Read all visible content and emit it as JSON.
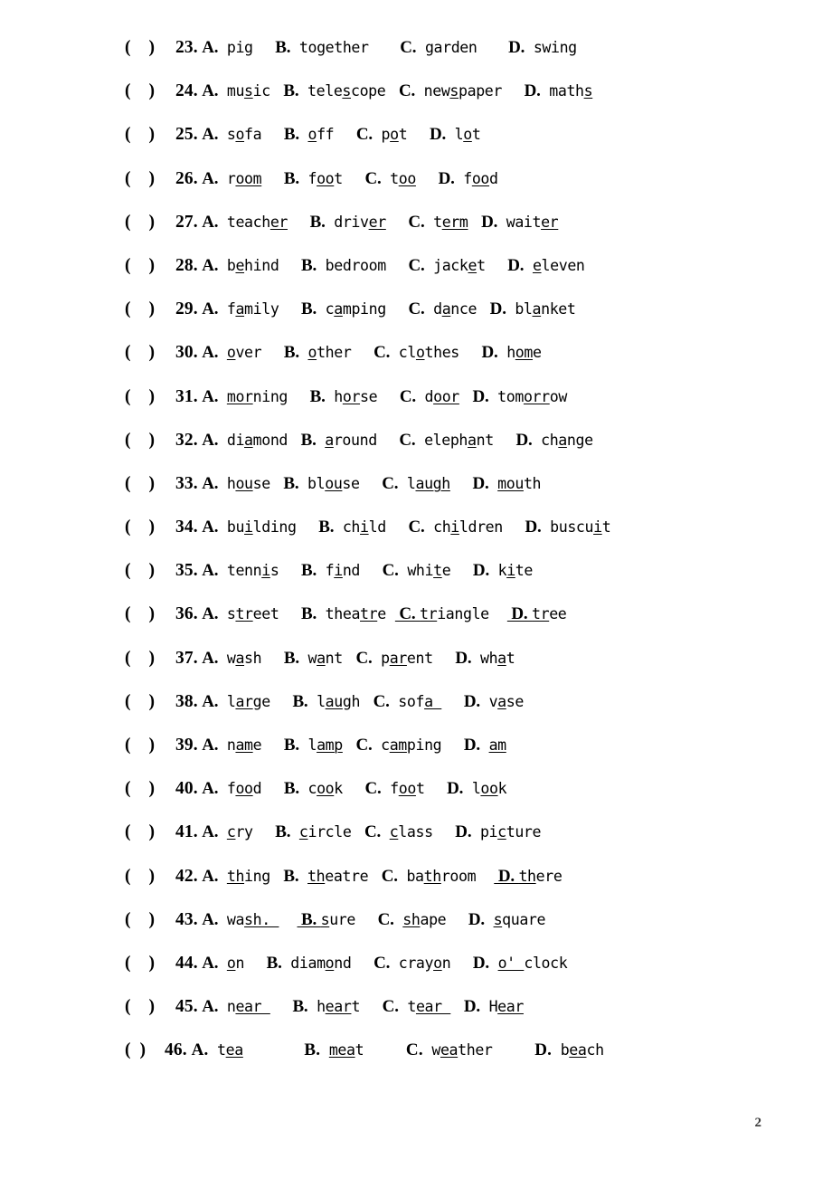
{
  "document": {
    "type": "worksheet",
    "subject": "English pronunciation multiple choice",
    "page_number": "2",
    "bracket": "(    )",
    "bracket_wide": "(  )"
  },
  "questions": [
    {
      "number": "23.",
      "options": [
        {
          "label": "A.",
          "pre": "pig",
          "mid": "",
          "post": ""
        },
        {
          "label": "B.",
          "pre": "together",
          "mid": "",
          "post": ""
        },
        {
          "label": "C.",
          "pre": "garden",
          "mid": "",
          "post": ""
        },
        {
          "label": "D.",
          "pre": "swing",
          "mid": "",
          "post": ""
        }
      ],
      "gaps": [
        2,
        3,
        3
      ]
    },
    {
      "number": "24.",
      "options": [
        {
          "label": "A.",
          "pre": "mu",
          "mid": "s",
          "post": "ic"
        },
        {
          "label": "B.",
          "pre": "tele",
          "mid": "s",
          "post": "cope"
        },
        {
          "label": "C.",
          "pre": "new",
          "mid": "s",
          "post": "paper"
        },
        {
          "label": "D.",
          "pre": "math",
          "mid": "s",
          "post": ""
        }
      ],
      "gaps": [
        1,
        1,
        2
      ]
    },
    {
      "number": "25.",
      "options": [
        {
          "label": "A.",
          "pre": "s",
          "mid": "o",
          "post": "fa"
        },
        {
          "label": "B.",
          "pre": "",
          "mid": "o",
          "post": "ff"
        },
        {
          "label": "C.",
          "pre": "p",
          "mid": "o",
          "post": "t"
        },
        {
          "label": "D.",
          "pre": "l",
          "mid": "o",
          "post": "t"
        }
      ],
      "gaps": [
        2,
        2,
        2
      ]
    },
    {
      "number": "26.",
      "options": [
        {
          "label": "A.",
          "pre": "r",
          "mid": "oom",
          "post": ""
        },
        {
          "label": "B.",
          "pre": "f",
          "mid": "oo",
          "post": "t"
        },
        {
          "label": "C.",
          "pre": "t",
          "mid": "oo",
          "post": ""
        },
        {
          "label": "D.",
          "pre": "f",
          "mid": "oo",
          "post": "d"
        }
      ],
      "gaps": [
        2,
        2,
        2
      ]
    },
    {
      "number": "27.",
      "options": [
        {
          "label": "A.",
          "pre": "teach",
          "mid": "er",
          "post": ""
        },
        {
          "label": "B.",
          "pre": "driv",
          "mid": "er",
          "post": ""
        },
        {
          "label": "C.",
          "pre": "t",
          "mid": "erm",
          "post": ""
        },
        {
          "label": "D.",
          "pre": "wait",
          "mid": "er",
          "post": ""
        }
      ],
      "gaps": [
        2,
        2,
        1
      ]
    },
    {
      "number": "28.",
      "options": [
        {
          "label": "A.",
          "pre": "b",
          "mid": "e",
          "post": "hind"
        },
        {
          "label": "B.",
          "pre": "bedroom",
          "mid": "",
          "post": ""
        },
        {
          "label": "C.",
          "pre": "jack",
          "mid": "e",
          "post": "t"
        },
        {
          "label": "D.",
          "pre": "",
          "mid": "e",
          "post": "leven"
        }
      ],
      "gaps": [
        2,
        2,
        2
      ]
    },
    {
      "number": "29.",
      "options": [
        {
          "label": "A.",
          "pre": "f",
          "mid": "a",
          "post": "mily"
        },
        {
          "label": "B.",
          "pre": "c",
          "mid": "a",
          "post": "mping"
        },
        {
          "label": "C.",
          "pre": "d",
          "mid": "a",
          "post": "nce"
        },
        {
          "label": "D.",
          "pre": "bl",
          "mid": "a",
          "post": "nket"
        }
      ],
      "gaps": [
        2,
        2,
        1
      ]
    },
    {
      "number": "30.",
      "options": [
        {
          "label": "A.",
          "pre": "",
          "mid": "o",
          "post": "ver"
        },
        {
          "label": "B.",
          "pre": "",
          "mid": "o",
          "post": "ther"
        },
        {
          "label": "C.",
          "pre": "cl",
          "mid": "o",
          "post": "thes"
        },
        {
          "label": "D.",
          "pre": "h",
          "mid": "om",
          "post": "e"
        }
      ],
      "gaps": [
        2,
        2,
        2
      ]
    },
    {
      "number": "31.",
      "options": [
        {
          "label": "A.",
          "pre": "",
          "mid": "mor",
          "post": "ning"
        },
        {
          "label": "B.",
          "pre": "h",
          "mid": "or",
          "post": "se"
        },
        {
          "label": "C.",
          "pre": "d",
          "mid": "oor",
          "post": ""
        },
        {
          "label": "D.",
          "pre": "tom",
          "mid": "orr",
          "post": "ow"
        }
      ],
      "gaps": [
        2,
        2,
        1
      ]
    },
    {
      "number": "32.",
      "options": [
        {
          "label": "A.",
          "pre": "di",
          "mid": "a",
          "post": "mond"
        },
        {
          "label": "B.",
          "pre": "",
          "mid": "a",
          "post": "round"
        },
        {
          "label": "C.",
          "pre": "eleph",
          "mid": "a",
          "post": "nt"
        },
        {
          "label": "D.",
          "pre": "ch",
          "mid": "a",
          "post": "nge"
        }
      ],
      "gaps": [
        1,
        2,
        2
      ]
    },
    {
      "number": "33.",
      "options": [
        {
          "label": "A.",
          "pre": "h",
          "mid": "ou",
          "post": "se"
        },
        {
          "label": "B.",
          "pre": "bl",
          "mid": "ou",
          "post": "se"
        },
        {
          "label": "C.",
          "pre": "l",
          "mid": "augh",
          "post": ""
        },
        {
          "label": "D.",
          "pre": "",
          "mid": "mou",
          "post": "th"
        }
      ],
      "gaps": [
        1,
        2,
        2
      ]
    },
    {
      "number": "34.",
      "options": [
        {
          "label": "A.",
          "pre": "bu",
          "mid": "i",
          "post": "lding"
        },
        {
          "label": "B.",
          "pre": "ch",
          "mid": "i",
          "post": "ld"
        },
        {
          "label": "C.",
          "pre": "ch",
          "mid": "i",
          "post": "ldren"
        },
        {
          "label": "D.",
          "pre": "buscu",
          "mid": "i",
          "post": "t"
        }
      ],
      "gaps": [
        2,
        2,
        2
      ]
    },
    {
      "number": "35.",
      "options": [
        {
          "label": "A.",
          "pre": "tenn",
          "mid": "i",
          "post": "s"
        },
        {
          "label": "B.",
          "pre": "f",
          "mid": "i",
          "post": "nd"
        },
        {
          "label": "C.",
          "pre": "whi",
          "mid": "t",
          "post": "e"
        },
        {
          "label": "D.",
          "pre": "k",
          "mid": "i",
          "post": "te"
        }
      ],
      "gaps": [
        2,
        2,
        2
      ]
    },
    {
      "number": "36.",
      "options": [
        {
          "label": "A.",
          "pre": "s",
          "mid": "tr",
          "post": "eet"
        },
        {
          "label": "B.",
          "pre": "thea",
          "mid": "tr",
          "post": "e"
        },
        {
          "label": "C.",
          "labelUnderlined": true,
          "pre": "",
          "mid": "tr",
          "post": "iangle"
        },
        {
          "label": "D.",
          "labelUnderlined": true,
          "pre": "",
          "mid": "tr",
          "post": "ee"
        }
      ],
      "gaps": [
        2,
        1,
        2
      ]
    },
    {
      "number": "37.",
      "options": [
        {
          "label": "A.",
          "pre": "w",
          "mid": "a",
          "post": "sh"
        },
        {
          "label": "B.",
          "pre": "w",
          "mid": "a",
          "post": "nt"
        },
        {
          "label": "C.",
          "pre": "p",
          "mid": "ar",
          "post": "ent"
        },
        {
          "label": "D.",
          "pre": "wh",
          "mid": "a",
          "post": "t"
        }
      ],
      "gaps": [
        2,
        1,
        2
      ]
    },
    {
      "number": "38.",
      "options": [
        {
          "label": "A.",
          "pre": "l",
          "mid": "ar",
          "post": "ge"
        },
        {
          "label": "B.",
          "pre": "l",
          "mid": "au",
          "post": "gh"
        },
        {
          "label": "C.",
          "pre": "sof",
          "mid": "a ",
          "post": ""
        },
        {
          "label": "D.",
          "pre": "v",
          "mid": "a",
          "post": "se"
        }
      ],
      "gaps": [
        2,
        1,
        2
      ]
    },
    {
      "number": "39.",
      "options": [
        {
          "label": "A.",
          "pre": "n",
          "mid": "am",
          "post": "e"
        },
        {
          "label": "B.",
          "pre": "l",
          "mid": "amp",
          "post": ""
        },
        {
          "label": "C.",
          "pre": "c",
          "mid": "am",
          "post": "ping"
        },
        {
          "label": "D.",
          "pre": "",
          "mid": "am",
          "post": ""
        }
      ],
      "gaps": [
        2,
        1,
        2
      ]
    },
    {
      "number": "40.",
      "options": [
        {
          "label": "A.",
          "pre": "f",
          "mid": "oo",
          "post": "d"
        },
        {
          "label": "B.",
          "pre": "c",
          "mid": "oo",
          "post": "k"
        },
        {
          "label": "C.",
          "pre": "f",
          "mid": "oo",
          "post": "t"
        },
        {
          "label": "D.",
          "pre": "l",
          "mid": "oo",
          "post": "k"
        }
      ],
      "gaps": [
        2,
        2,
        2
      ]
    },
    {
      "number": "41.",
      "options": [
        {
          "label": "A.",
          "pre": "",
          "mid": "c",
          "post": "ry"
        },
        {
          "label": "B.",
          "pre": "",
          "mid": "c",
          "post": "ircle"
        },
        {
          "label": "C.",
          "pre": "",
          "mid": "c",
          "post": "lass"
        },
        {
          "label": "D.",
          "pre": "pi",
          "mid": "c",
          "post": "ture"
        }
      ],
      "gaps": [
        2,
        1,
        2
      ]
    },
    {
      "number": "42.",
      "options": [
        {
          "label": "A.",
          "pre": "",
          "mid": "th",
          "post": "ing"
        },
        {
          "label": "B.",
          "pre": "",
          "mid": "th",
          "post": "eatre"
        },
        {
          "label": "C.",
          "pre": "ba",
          "mid": "th",
          "post": "room"
        },
        {
          "label": "D.",
          "labelUnderlined": true,
          "pre": "",
          "mid": "th",
          "post": "ere"
        }
      ],
      "gaps": [
        1,
        1,
        2
      ]
    },
    {
      "number": "43.",
      "options": [
        {
          "label": "A.",
          "pre": "wa",
          "mid": "sh. ",
          "post": ""
        },
        {
          "label": "B.",
          "labelUnderlined": true,
          "pre": "",
          "mid": "s",
          "post": "ure"
        },
        {
          "label": "C.",
          "pre": "",
          "mid": "sh",
          "post": "ape"
        },
        {
          "label": "D.",
          "pre": "",
          "mid": "s",
          "post": "quare"
        }
      ],
      "gaps": [
        2,
        2,
        2
      ]
    },
    {
      "number": "44.",
      "options": [
        {
          "label": "A.",
          "pre": "",
          "mid": "o",
          "post": "n"
        },
        {
          "label": "B.",
          "pre": "diam",
          "mid": "o",
          "post": "nd"
        },
        {
          "label": "C.",
          "pre": "cray",
          "mid": "o",
          "post": "n"
        },
        {
          "label": "D.",
          "pre": "",
          "mid": "o' ",
          "post": "clock"
        }
      ],
      "gaps": [
        2,
        2,
        2
      ]
    },
    {
      "number": "45.",
      "options": [
        {
          "label": "A.",
          "pre": "n",
          "mid": "ear ",
          "post": ""
        },
        {
          "label": "B.",
          "pre": "h",
          "mid": "ear",
          "post": "t"
        },
        {
          "label": "C.",
          "pre": "t",
          "mid": "ear ",
          "post": ""
        },
        {
          "label": "D.",
          "pre": "H",
          "mid": "ear",
          "post": ""
        }
      ],
      "gaps": [
        2,
        2,
        1
      ]
    },
    {
      "number": "46.",
      "wide": true,
      "options": [
        {
          "label": "A.",
          "pre": "t",
          "mid": "ea",
          "post": ""
        },
        {
          "label": "B.",
          "pre": "",
          "mid": "mea",
          "post": "t"
        },
        {
          "label": "C.",
          "pre": "w",
          "mid": "ea",
          "post": "ther"
        },
        {
          "label": "D.",
          "pre": "b",
          "mid": "ea",
          "post": "ch"
        }
      ],
      "gaps": [
        6,
        4,
        4
      ]
    }
  ]
}
